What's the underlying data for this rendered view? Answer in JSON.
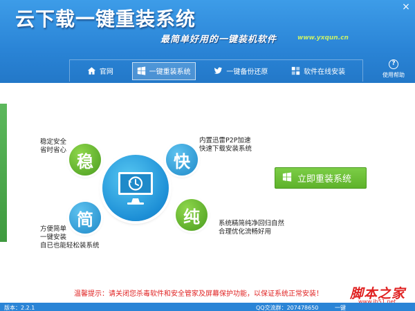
{
  "header": {
    "title": "云下载一键重装系统",
    "slogan": "最简单好用的一键装机软件",
    "website": "www.yxqun.cn",
    "close_label": "×"
  },
  "nav": {
    "items": [
      {
        "label": "官网",
        "icon": "home-icon"
      },
      {
        "label": "一键重装系统",
        "icon": "windows-icon",
        "active": true
      },
      {
        "label": "一键备份还原",
        "icon": "bird-icon"
      },
      {
        "label": "软件在线安装",
        "icon": "grid-icon"
      }
    ],
    "help": {
      "label": "使用帮助",
      "icon": "help-icon"
    }
  },
  "features": {
    "stable": {
      "badge": "稳",
      "lines": [
        "稳定安全",
        "省时省心"
      ]
    },
    "fast": {
      "badge": "快",
      "lines": [
        "内置迅雷P2P加速",
        "快速下载安装系统"
      ]
    },
    "easy": {
      "badge": "简",
      "lines": [
        "方便简单",
        "一键安装",
        "自已也能轻松装系统"
      ]
    },
    "pure": {
      "badge": "纯",
      "lines": [
        "系统精简纯净回归自然",
        "合理优化流畅好用"
      ]
    }
  },
  "actions": {
    "reinstall_label": "立即重装系统"
  },
  "warning": "温馨提示：请关闭您杀毒软件和安全管家及屏幕保护功能，以保证系统正常安装！",
  "watermark": {
    "text": "脚本之家",
    "url": "www.jb51.net"
  },
  "status": {
    "version": "版本：2.2.1",
    "qq": "QQ交流群：207478650",
    "link": "一键"
  },
  "colors": {
    "header_blue": "#2a84d6",
    "green": "#5eb22b",
    "warning_red": "#e02222"
  }
}
